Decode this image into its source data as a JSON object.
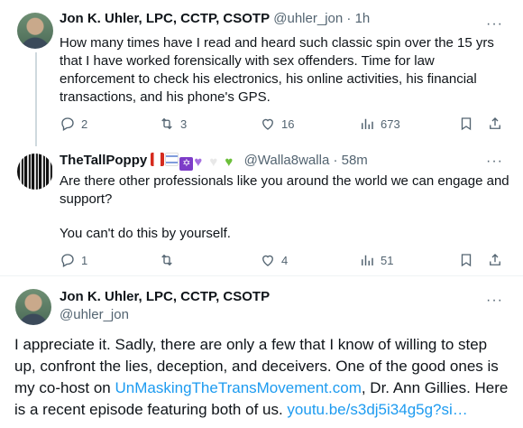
{
  "tweet1": {
    "name": "Jon K. Uhler, LPC, CCTP, CSOTP",
    "handle": "@uhler_jon",
    "sep": "·",
    "time": "1h",
    "more": "···",
    "text_lines": [
      "How many times have I read and heard such classic spin over the 15 yrs",
      "that I have worked forensically with sex offenders. Time for law",
      "enforcement to check his electronics, his online activities, his financial",
      "transactions, and his phone's GPS."
    ],
    "replies": "2",
    "reposts": "3",
    "likes": "16",
    "views": "673"
  },
  "tweet2": {
    "name": "TheTallPoppy",
    "badges": [
      "canada-flag",
      "israel-flag",
      "star-of-david",
      "purple-heart",
      "white-heart",
      "green-heart"
    ],
    "handle": "@Walla8walla",
    "sep": "·",
    "time": "58m",
    "more": "···",
    "text_lines": [
      "Are there other professionals like you around the world we can engage and",
      "support?",
      "",
      "You can't do this by yourself."
    ],
    "replies": "1",
    "reposts": "",
    "likes": "4",
    "views": "51"
  },
  "tweet3": {
    "name": "Jon K. Uhler, LPC, CCTP, CSOTP",
    "handle": "@uhler_jon",
    "more": "···",
    "line1": "I appreciate it. Sadly, there are only a few that I know of willing to step",
    "line2": "up, confront the lies, deception, and deceivers. One of the good ones is",
    "line3_pre": "my co-host on ",
    "line3_link": "UnMaskingTheTransMovement.com",
    "line3_post": ", Dr. Ann Gillies.  Here",
    "line4_pre": "is a recent episode featuring both of us.  ",
    "line4_link": "youtu.be/s3dj5i34g5g?si…"
  },
  "colors": {
    "link": "#1d9bf0",
    "secondary": "#536471",
    "text": "#0f1419"
  }
}
